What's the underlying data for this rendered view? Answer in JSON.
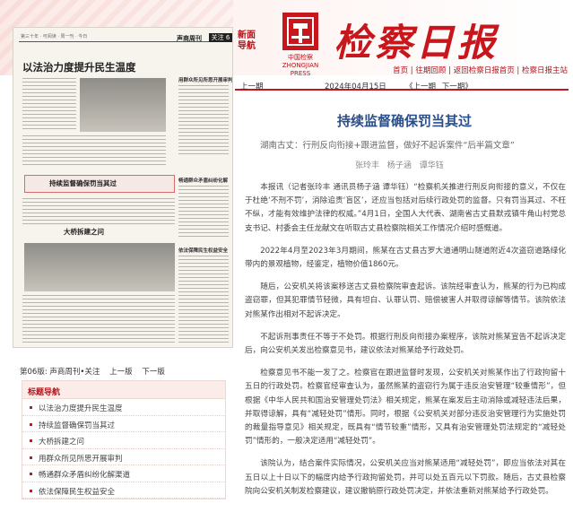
{
  "header": {
    "side_tag": "新面导航",
    "logo_sub_line1": "中国检察",
    "logo_sub_line2": "ZHONGJIAN PRESS",
    "masthead": "检察日报",
    "links": [
      "首页",
      "往期回顾",
      "返回检察日报首页",
      "检察日报主站"
    ]
  },
  "paper": {
    "top_small": "第三十年 · 可阅读 · 周一刊 · 今日",
    "section_name": "声商周刊",
    "section_box": "关注 6",
    "headline": "以法治力度提升民生温度",
    "sub1": "持续监督确保罚当其过",
    "sub2": "大桥拆建之问",
    "right_titles": [
      "用群众所见所思开展审判",
      "畅通群众矛盾纠纷化解",
      "依法保障民生权益安全"
    ]
  },
  "page_bar": {
    "edition": "第06版: 声商周刊•关注",
    "prev": "上一版",
    "next": "下一版"
  },
  "nav": {
    "title": "标题导航",
    "items": [
      "以法治力度提升民生温度",
      "持续监督确保罚当其过",
      "大桥拆建之问",
      "用群众所见所思开展审判",
      "畅通群众矛盾纠纷化解渠道",
      "依法保障民生权益安全"
    ]
  },
  "infobar": {
    "edition": "上一期",
    "date": "2024年04月15日",
    "prev": "《上一期",
    "next": "下一期》"
  },
  "article": {
    "title": "持续监督确保罚当其过",
    "subtitle": "湖南古丈：行刑反向衔接+跟进监督，做好不起诉案件“后半篇文章”",
    "authors": "张玲丰  杨子涵  谭华钰",
    "paragraphs": [
      "本报讯（记者张玲丰 通讯员杨子涵 谭华钰）“检察机关推进行刑反向衔接的意义，不仅在于杜绝‘不刑不罚’，消除追责‘盲区’，还应当包括对后续行政处罚的监督。只有罚当其过、不枉不纵，才能有效维护法律的权威。”4月1日，全国人大代表、湖南省古丈县默戎镇牛角山村党总支书记、村委会主任龙献文在听取古丈县检察院相关工作情况介绍时感慨道。",
      "2022年4月至2023年3月期间，熊某在古丈县古罗大道通明山隧道附近4次盗窃道路绿化带内的景观植物，经鉴定，植物价值1860元。",
      "随后，公安机关将该案移送古丈县检察院审查起诉。该院经审查认为，熊某的行为已构成盗窃罪，但其犯罪情节轻微，具有坦白、认罪认罚、赔偿被害人并取得谅解等情节。该院依法对熊某作出相对不起诉决定。",
      "不起诉刑事责任不等于不处罚。根据行刑反向衔接办案程序，该院对熊某宣告不起诉决定后，向公安机关发出检察意见书，建议依法对熊某给予行政处罚。",
      "检察意见书不能一发了之。检察官在跟进监督时发现，公安机关对熊某作出了行政拘留十五日的行政处罚。检察官经审查认为，虽然熊某的盗窃行为属于违反治安管理“较重情形”，但根据《中华人民共和国治安管理处罚法》相关规定，熊某在案发后主动消除或减轻违法后果，并取得谅解，具有“减轻处罚”情形。同时，根据《公安机关对部分违反治安管理行为实施处罚的裁量指导意见》相关规定，既具有“情节较重”情形，又具有治安管理处罚法规定的“减轻处罚”情形的，一般决定适用“减轻处罚”。",
      "该院认为，结合案件实际情况，公安机关应当对熊某适用“减轻处罚”，即应当依法对其在五日以上十日以下的幅度内给予行政拘留处罚，并可以处五百元以下罚款。随后，古丈县检察院向公安机关制发检察建议，建议撤销原行政处罚决定，并依法重新对熊某给予行政处罚。"
    ]
  }
}
